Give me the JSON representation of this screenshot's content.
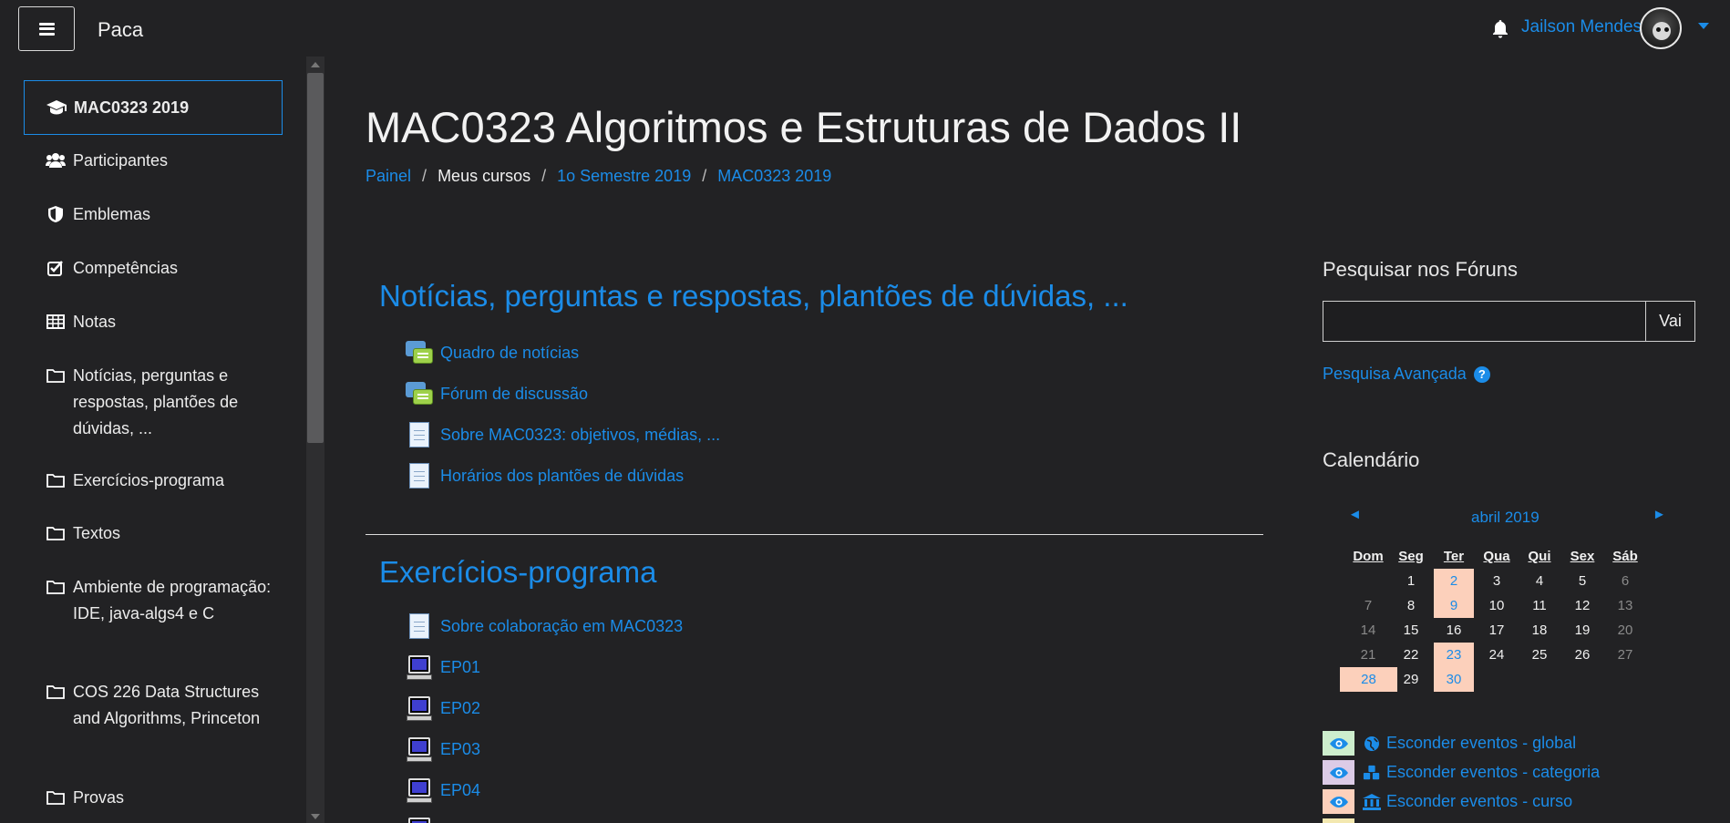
{
  "navbar": {
    "brand": "Paca",
    "user_name": "Jailson Mendes"
  },
  "sidebar": {
    "items": [
      {
        "label": "MAC0323 2019",
        "icon": "graduation-cap-icon"
      },
      {
        "label": "Participantes",
        "icon": "users-icon"
      },
      {
        "label": "Emblemas",
        "icon": "shield-icon"
      },
      {
        "label": "Competências",
        "icon": "checkbox-icon"
      },
      {
        "label": "Notas",
        "icon": "table-icon"
      },
      {
        "label": "Notícias, perguntas e respostas, plantões de dúvidas, ...",
        "icon": "folder-icon"
      },
      {
        "label": "Exercícios-programa",
        "icon": "folder-icon"
      },
      {
        "label": "Textos",
        "icon": "folder-icon"
      },
      {
        "label": "Ambiente de programação: IDE, java-algs4 e C",
        "icon": "folder-icon"
      },
      {
        "label": "COS 226 Data Structures and Algorithms, Princeton",
        "icon": "folder-icon"
      },
      {
        "label": "Provas",
        "icon": "folder-icon"
      }
    ]
  },
  "main": {
    "title": "MAC0323 Algoritmos e Estruturas de Dados II",
    "breadcrumb": [
      "Painel",
      "Meus cursos",
      "1o Semestre 2019",
      "MAC0323 2019"
    ],
    "sections": [
      {
        "title": "Notícias, perguntas e respostas, plantões de dúvidas, ...",
        "activities": [
          {
            "label": "Quadro de notícias",
            "icon": "forum-icon"
          },
          {
            "label": "Fórum de discussão",
            "icon": "forum-icon"
          },
          {
            "label": "Sobre MAC0323: objetivos, médias, ...",
            "icon": "page-icon"
          },
          {
            "label": "Horários dos plantões de dúvidas",
            "icon": "page-icon"
          }
        ]
      },
      {
        "title": "Exercícios-programa",
        "activities": [
          {
            "label": "Sobre colaboração em MAC0323",
            "icon": "page-icon"
          },
          {
            "label": "EP01",
            "icon": "computer-icon"
          },
          {
            "label": "EP02",
            "icon": "computer-icon"
          },
          {
            "label": "EP03",
            "icon": "computer-icon"
          },
          {
            "label": "EP04",
            "icon": "computer-icon"
          }
        ]
      }
    ]
  },
  "search_forums": {
    "title": "Pesquisar nos Fóruns",
    "input_value": "",
    "button_label": "Vai",
    "advanced_label": "Pesquisa Avançada",
    "help_label": "?"
  },
  "calendar": {
    "title": "Calendário",
    "month_label": "abril 2019",
    "prev_label": "◄",
    "next_label": "►",
    "weekdays": [
      "Dom",
      "Seg",
      "Ter",
      "Qua",
      "Qui",
      "Sex",
      "Sáb"
    ],
    "weeks": [
      [
        "",
        "1",
        "2",
        "3",
        "4",
        "5",
        "6"
      ],
      [
        "7",
        "8",
        "9",
        "10",
        "11",
        "12",
        "13"
      ],
      [
        "14",
        "15",
        "16",
        "17",
        "18",
        "19",
        "20"
      ],
      [
        "21",
        "22",
        "23",
        "24",
        "25",
        "26",
        "27"
      ],
      [
        "28",
        "29",
        "30",
        "",
        "",
        "",
        ""
      ]
    ],
    "event_days": [
      "2",
      "9",
      "23",
      "28",
      "30"
    ],
    "event_color": "#fcd0bb"
  },
  "event_filters": [
    {
      "label": "Esconder eventos - global",
      "swatch": "#cdeecd",
      "icon": "globe-icon"
    },
    {
      "label": "Esconder eventos - categoria",
      "swatch": "#dccbe6",
      "icon": "cubes-icon"
    },
    {
      "label": "Esconder eventos - curso",
      "swatch": "#fcd0bb",
      "icon": "institution-icon"
    }
  ],
  "colors": {
    "background": "#222224",
    "link": "#1b8ce8",
    "event_highlight": "#fcd0bb"
  }
}
